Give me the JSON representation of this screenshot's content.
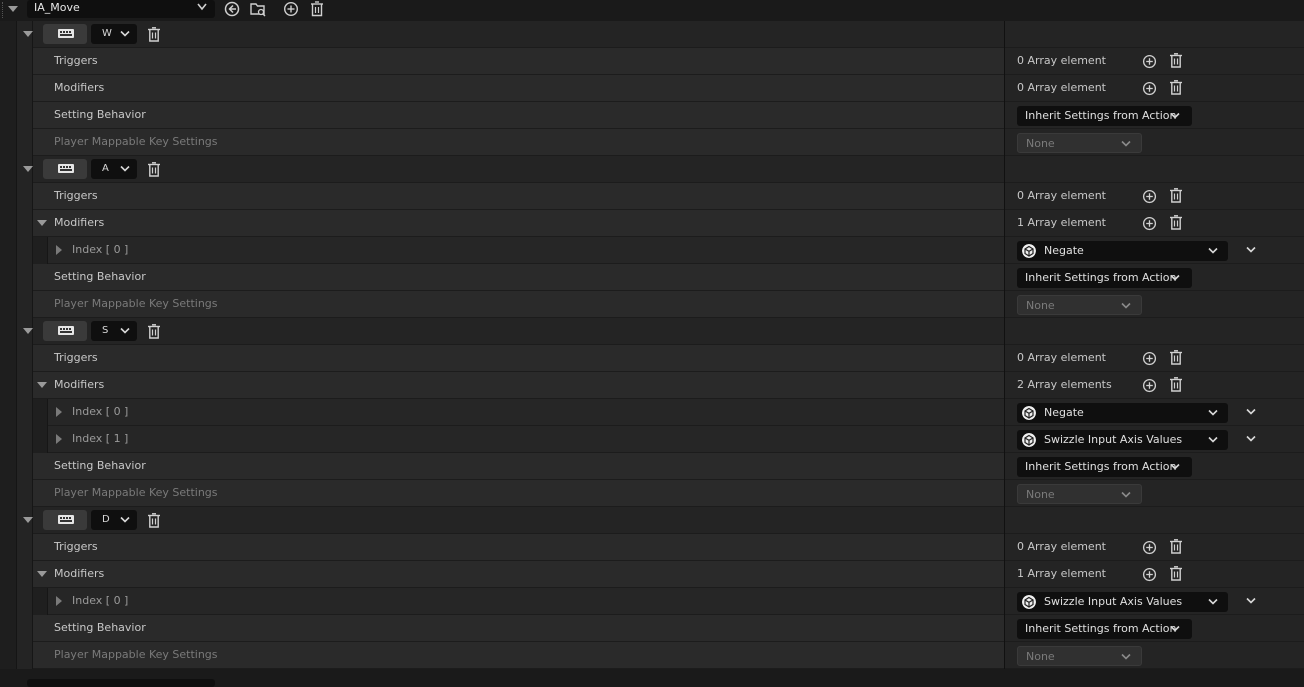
{
  "toolbar": {
    "action_name": "IA_Move",
    "icons": [
      "use-selected-icon",
      "browse-icon",
      "add-icon",
      "delete-icon"
    ]
  },
  "labels": {
    "triggers": "Triggers",
    "modifiers": "Modifiers",
    "setting_behavior": "Setting Behavior",
    "player_mappable": "Player Mappable Key Settings"
  },
  "mappings": [
    {
      "key": "W",
      "triggers_count": "0 Array element",
      "modifiers_count": "0 Array element",
      "modifiers_expanded": false,
      "modifiers": [],
      "setting_behavior": "Inherit Settings from Action",
      "player_mappable": "None"
    },
    {
      "key": "A",
      "triggers_count": "0 Array element",
      "modifiers_count": "1 Array element",
      "modifiers_expanded": true,
      "modifiers": [
        {
          "index": "Index [ 0 ]",
          "value": "Negate"
        }
      ],
      "setting_behavior": "Inherit Settings from Action",
      "player_mappable": "None"
    },
    {
      "key": "S",
      "triggers_count": "0 Array element",
      "modifiers_count": "2 Array elements",
      "modifiers_expanded": true,
      "modifiers": [
        {
          "index": "Index [ 0 ]",
          "value": "Negate"
        },
        {
          "index": "Index [ 1 ]",
          "value": "Swizzle Input Axis Values"
        }
      ],
      "setting_behavior": "Inherit Settings from Action",
      "player_mappable": "None"
    },
    {
      "key": "D",
      "triggers_count": "0 Array element",
      "modifiers_count": "1 Array element",
      "modifiers_expanded": true,
      "modifiers": [
        {
          "index": "Index [ 0 ]",
          "value": "Swizzle Input Axis Values"
        }
      ],
      "setting_behavior": "Inherit Settings from Action",
      "player_mappable": "None"
    }
  ],
  "colors": {
    "background": "#1a1a1a",
    "row": "#2a2a2a",
    "dropdown": "#0f0f0f",
    "text": "#c8c8c8",
    "dim_text": "#7a7a7a"
  }
}
